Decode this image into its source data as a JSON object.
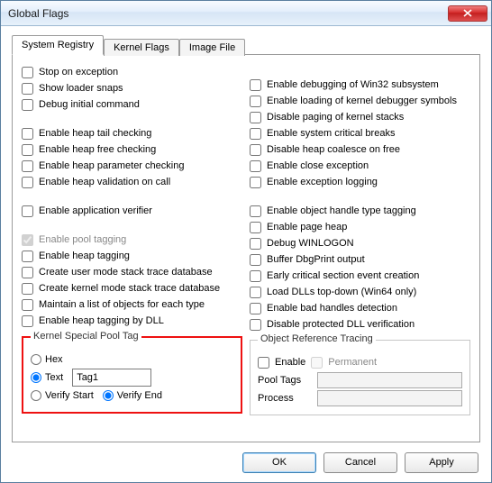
{
  "window": {
    "title": "Global Flags"
  },
  "tabs": {
    "system_registry": "System Registry",
    "kernel_flags": "Kernel Flags",
    "image_file": "Image File"
  },
  "left": {
    "stop_on_exception": "Stop on exception",
    "show_loader_snaps": "Show loader snaps",
    "debug_initial_command": "Debug initial command",
    "enable_heap_tail_checking": "Enable heap tail checking",
    "enable_heap_free_checking": "Enable heap free checking",
    "enable_heap_parameter_checking": "Enable heap parameter checking",
    "enable_heap_validation_on_call": "Enable heap validation on call",
    "enable_application_verifier": "Enable application verifier",
    "enable_pool_tagging": "Enable pool tagging",
    "enable_heap_tagging": "Enable heap tagging",
    "create_user_mode_stack_trace_db": "Create user mode stack trace database",
    "create_kernel_mode_stack_trace_db": "Create kernel mode stack trace database",
    "maintain_list_objects": "Maintain a list of objects for each type",
    "enable_heap_tagging_by_dll": "Enable heap tagging by DLL"
  },
  "right": {
    "enable_debugging_win32": "Enable debugging of Win32 subsystem",
    "enable_loading_kd_symbols": "Enable loading of kernel debugger symbols",
    "disable_paging_kernel_stacks": "Disable paging of kernel stacks",
    "enable_system_critical_breaks": "Enable system critical breaks",
    "disable_heap_coalesce_on_free": "Disable heap coalesce on free",
    "enable_close_exception": "Enable close exception",
    "enable_exception_logging": "Enable exception logging",
    "enable_object_handle_type_tagging": "Enable object handle type tagging",
    "enable_page_heap": "Enable page heap",
    "debug_winlogon": "Debug WINLOGON",
    "buffer_dbgprint_output": "Buffer DbgPrint output",
    "early_critical_section_event_creation": "Early critical section event creation",
    "load_dlls_top_down": "Load DLLs top-down (Win64 only)",
    "enable_bad_handles_detection": "Enable bad handles detection",
    "disable_protected_dll_verification": "Disable protected DLL verification"
  },
  "special_pool": {
    "legend": "Kernel Special Pool Tag",
    "hex": "Hex",
    "text": "Text",
    "tag_value": "Tag1",
    "verify_start": "Verify Start",
    "verify_end": "Verify End"
  },
  "ort": {
    "legend": "Object Reference Tracing",
    "enable": "Enable",
    "permanent": "Permanent",
    "pool_tags": "Pool Tags",
    "process": "Process",
    "pool_tags_value": "",
    "process_value": ""
  },
  "buttons": {
    "ok": "OK",
    "cancel": "Cancel",
    "apply": "Apply"
  }
}
